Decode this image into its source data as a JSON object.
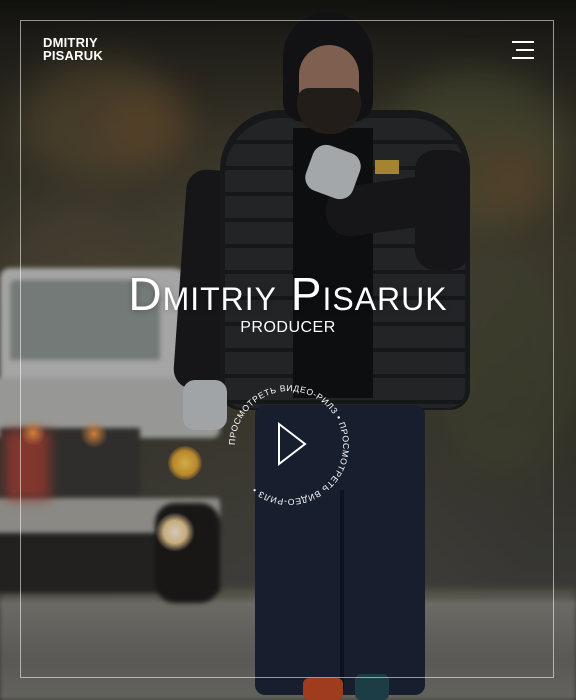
{
  "header": {
    "logo_line1": "DMITRIY",
    "logo_line2": "PISARUK",
    "menu_icon": "hamburger-menu-icon"
  },
  "hero": {
    "name": "Dmitriy Pisaruk",
    "role": "PRODUCER",
    "play_ring_text": "ПРОСМОТРЕТЬ ВИДЕО-РИЛЗ • ПРОСМОТРЕТЬ ВИДЕО-РИЛЗ • ",
    "play_icon": "play-icon"
  },
  "colors": {
    "text": "#ffffff",
    "frame": "#ffffff"
  }
}
